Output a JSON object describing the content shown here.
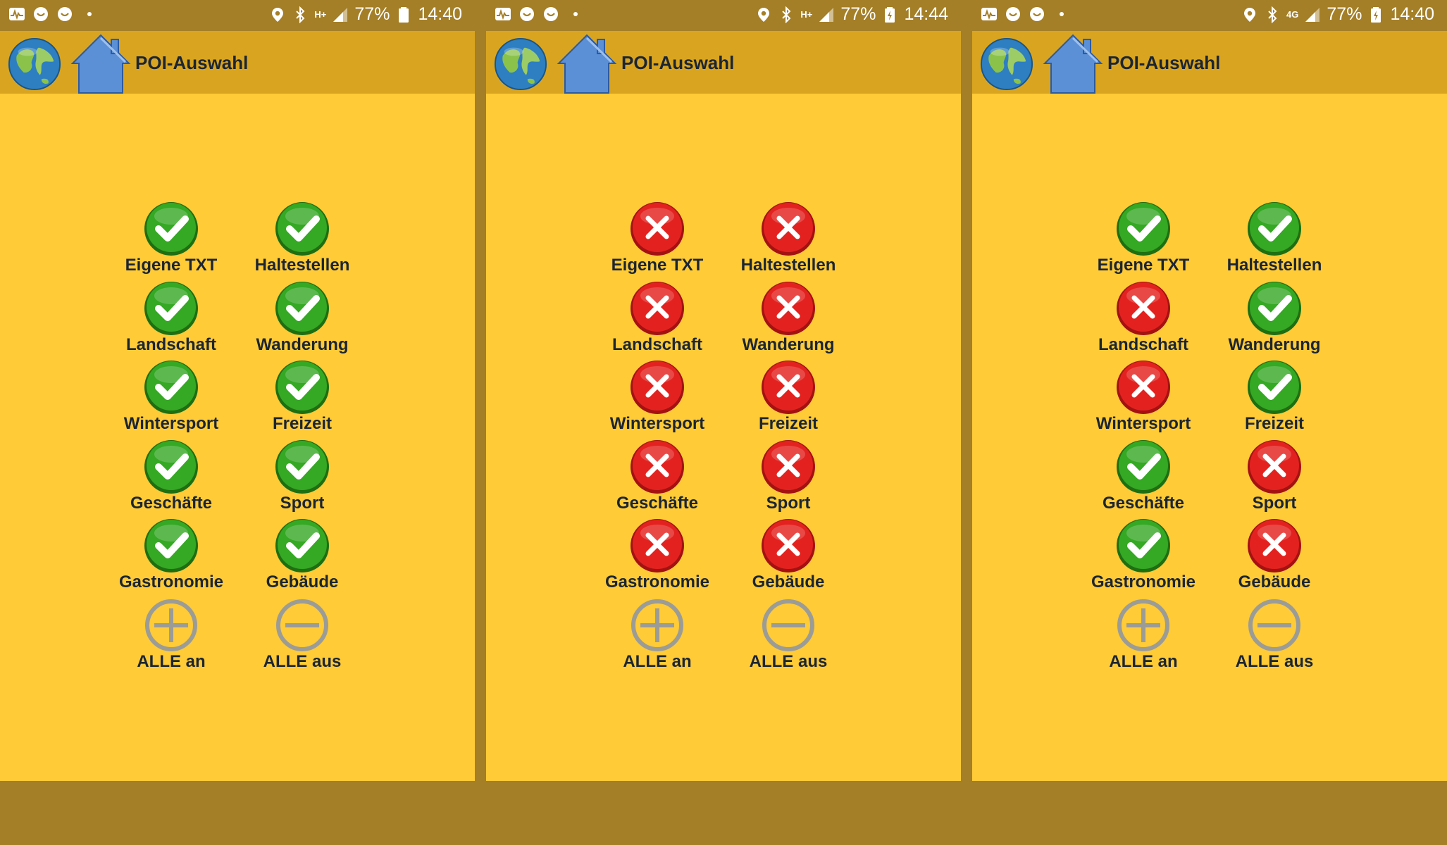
{
  "colors": {
    "frame": "#a47f27",
    "header": "#d9a520",
    "content": "#ffcb36",
    "text": "#1b2533",
    "on": "#2e9a1f",
    "off": "#e3221f",
    "control": "#9c9c96"
  },
  "screens": [
    {
      "status": {
        "battery": "77%",
        "time": "14:40",
        "network": "H+"
      },
      "header": {
        "title": "POI-Auswahl",
        "globe_icon": "globe-icon",
        "home_icon": "home-icon"
      },
      "items": [
        {
          "label": "Eigene TXT",
          "state": "on"
        },
        {
          "label": "Haltestellen",
          "state": "on"
        },
        {
          "label": "Landschaft",
          "state": "on"
        },
        {
          "label": "Wanderung",
          "state": "on"
        },
        {
          "label": "Wintersport",
          "state": "on"
        },
        {
          "label": "Freizeit",
          "state": "on"
        },
        {
          "label": "Geschäfte",
          "state": "on"
        },
        {
          "label": "Sport",
          "state": "on"
        },
        {
          "label": "Gastronomie",
          "state": "on"
        },
        {
          "label": "Gebäude",
          "state": "on"
        }
      ],
      "controls": {
        "all_on": "ALLE an",
        "all_off": "ALLE aus"
      }
    },
    {
      "status": {
        "battery": "77%",
        "time": "14:44",
        "network": "H+"
      },
      "header": {
        "title": "POI-Auswahl",
        "globe_icon": "globe-icon",
        "home_icon": "home-icon"
      },
      "items": [
        {
          "label": "Eigene TXT",
          "state": "off"
        },
        {
          "label": "Haltestellen",
          "state": "off"
        },
        {
          "label": "Landschaft",
          "state": "off"
        },
        {
          "label": "Wanderung",
          "state": "off"
        },
        {
          "label": "Wintersport",
          "state": "off"
        },
        {
          "label": "Freizeit",
          "state": "off"
        },
        {
          "label": "Geschäfte",
          "state": "off"
        },
        {
          "label": "Sport",
          "state": "off"
        },
        {
          "label": "Gastronomie",
          "state": "off"
        },
        {
          "label": "Gebäude",
          "state": "off"
        }
      ],
      "controls": {
        "all_on": "ALLE an",
        "all_off": "ALLE aus"
      }
    },
    {
      "status": {
        "battery": "77%",
        "time": "14:40",
        "network": "4G"
      },
      "header": {
        "title": "POI-Auswahl",
        "globe_icon": "globe-icon",
        "home_icon": "home-icon"
      },
      "items": [
        {
          "label": "Eigene TXT",
          "state": "on"
        },
        {
          "label": "Haltestellen",
          "state": "on"
        },
        {
          "label": "Landschaft",
          "state": "off"
        },
        {
          "label": "Wanderung",
          "state": "on"
        },
        {
          "label": "Wintersport",
          "state": "off"
        },
        {
          "label": "Freizeit",
          "state": "on"
        },
        {
          "label": "Geschäfte",
          "state": "on"
        },
        {
          "label": "Sport",
          "state": "off"
        },
        {
          "label": "Gastronomie",
          "state": "on"
        },
        {
          "label": "Gebäude",
          "state": "off"
        }
      ],
      "controls": {
        "all_on": "ALLE an",
        "all_off": "ALLE aus"
      }
    }
  ]
}
